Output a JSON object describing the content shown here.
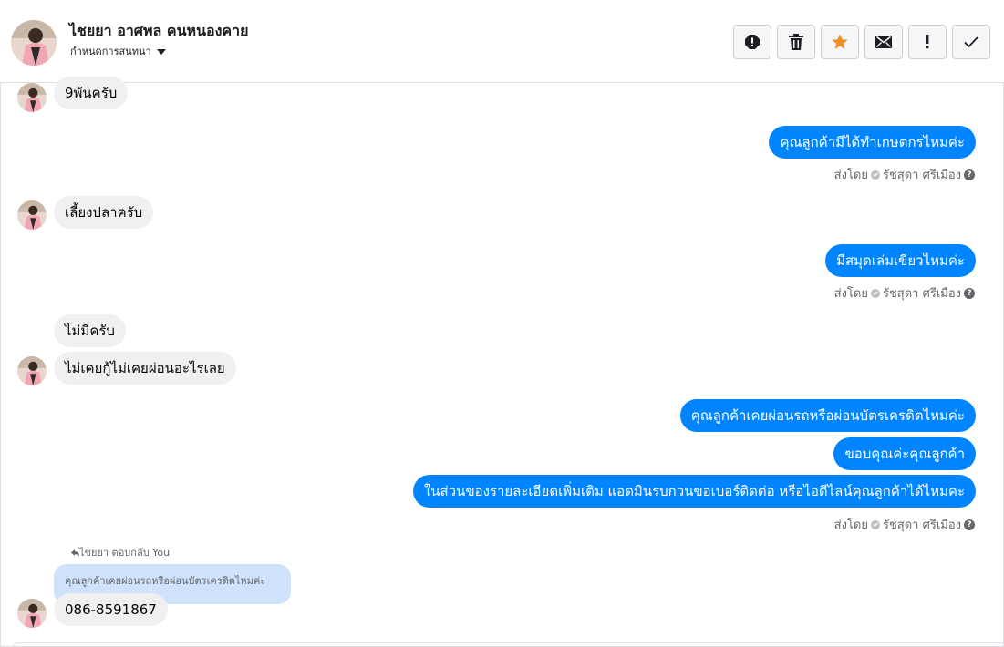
{
  "header": {
    "name": "ไชยยา อาศพล คนหนองคาย",
    "assign_label": "กำหนดการสนทนา"
  },
  "toolbar": {
    "buttons": [
      "alert-icon",
      "trash-icon",
      "star-icon",
      "envelope-icon",
      "exclamation-icon",
      "checkmark-icon"
    ],
    "star_color": "#f08e2a"
  },
  "messages": {
    "m1": "9พันครับ",
    "m2": "คุณลูกค้ามีได้ทำเกษตกรไหมค่ะ",
    "m3": "เลี้ยงปลาครับ",
    "m4": "มีสมุดเล่มเขียวไหมค่ะ",
    "m5": "ไม่มีครับ",
    "m6": "ไม่เคยกู้ไม่เคยผ่อนอะไรเลย",
    "m7": "คุณลูกค้าเคยผ่อนรถหรือผ่อนบัตรเครดิตไหมค่ะ",
    "m8": "ขอบคุณค่ะคุณลูกค้า",
    "m9": "ในส่วนของรายละเอียดเพิ่มเติม แอดมินรบกวนขอเบอร์ติดต่อ หรือไอดีไลน์คุณลูกค้าได้ไหมคะ",
    "m10": "086-8591867"
  },
  "sent_by": {
    "label": "ส่งโดย",
    "agent": "รัชสุดา ศรีเมือง"
  },
  "reply": {
    "label": "ไชยยา ตอบกลับ You",
    "quoted_text": "คุณลูกค้าเคยผ่อนรถหรือผ่อนบัตรเครดิตไหมค่ะ"
  },
  "colors": {
    "outgoing_bubble": "#0084ff",
    "incoming_bubble": "#f0f0f0",
    "quoted_bubble": "#cfe2fb"
  }
}
